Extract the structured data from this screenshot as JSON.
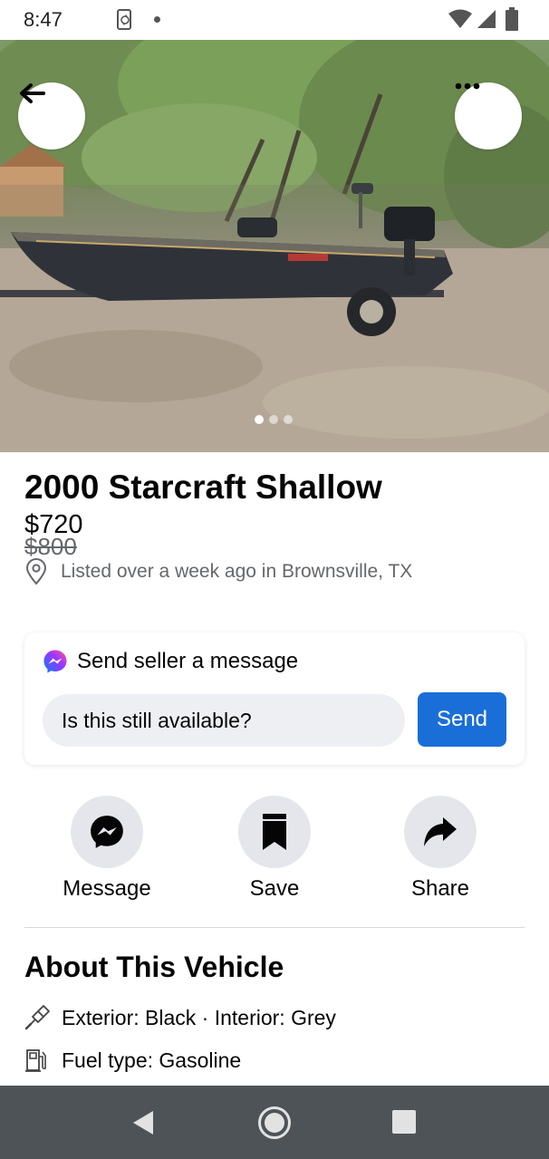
{
  "status_bar": {
    "time": "8:47",
    "icons": [
      "phone-sync-icon",
      "notification-dot-icon",
      "wifi-icon",
      "signal-icon",
      "battery-icon"
    ]
  },
  "photo": {
    "alt_subject": "boat on trailer",
    "carousel_total": 3,
    "carousel_active_index": 0
  },
  "listing": {
    "title": "2000 Starcraft Shallow",
    "price": "$720",
    "old_price": "$800",
    "location": "Listed over a week ago in Brownsville, TX"
  },
  "message_card": {
    "header": "Send seller a message",
    "input_value": "Is this still available?",
    "send_label": "Send"
  },
  "actions": {
    "message_label": "Message",
    "save_label": "Save",
    "share_label": "Share"
  },
  "about": {
    "title": "About This Vehicle",
    "exterior": "Exterior: Black · Interior: Grey",
    "fuel": "Fuel type: Gasoline"
  },
  "colors": {
    "accent": "#1a6ed8",
    "secondary_text": "#65676b",
    "button_bg": "#e4e6eb",
    "nav_bar": "#4e5358"
  }
}
